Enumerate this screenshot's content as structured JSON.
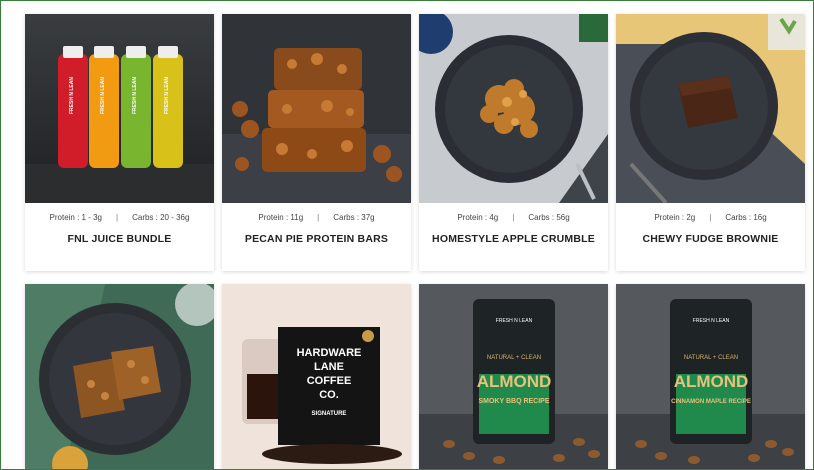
{
  "products": [
    {
      "title": "FNL JUICE BUNDLE",
      "protein": "Protein : 1 - 3g",
      "carbs": "Carbs : 20 - 36g",
      "image_icon": "juice-bottles-image",
      "bottle_brand": "FRESH N LEAN"
    },
    {
      "title": "PECAN PIE PROTEIN BARS",
      "protein": "Protein : 11g",
      "carbs": "Carbs : 37g",
      "image_icon": "protein-bars-image"
    },
    {
      "title": "HOMESTYLE APPLE CRUMBLE",
      "protein": "Protein : 4g",
      "carbs": "Carbs : 56g",
      "image_icon": "apple-crumble-image"
    },
    {
      "title": "CHEWY FUDGE BROWNIE",
      "protein": "Protein : 2g",
      "carbs": "Carbs : 16g",
      "image_icon": "brownie-image"
    },
    {
      "title": "",
      "image_icon": "granola-bar-image"
    },
    {
      "title": "",
      "image_icon": "coffee-bag-image",
      "package_text": [
        "HARDWARE",
        "LANE",
        "COFFEE",
        "CO."
      ],
      "package_sub": "SIGNATURE"
    },
    {
      "title": "",
      "image_icon": "almond-bag-bbq-image",
      "package_brand": "FRESH N LEAN",
      "package_small": "NATURAL + CLEAN",
      "package_big": "ALMOND",
      "package_flavor": "SMOKY BBQ RECIPE"
    },
    {
      "title": "",
      "image_icon": "almond-bag-maple-image",
      "package_brand": "FRESH N LEAN",
      "package_small": "NATURAL + CLEAN",
      "package_big": "ALMOND",
      "package_flavor": "CINNAMON MAPLE RECIPE"
    }
  ],
  "colors": {
    "border": "#3a7d3a",
    "text": "#222222",
    "meta": "#444444",
    "almond_green": "#1f8a4c"
  }
}
